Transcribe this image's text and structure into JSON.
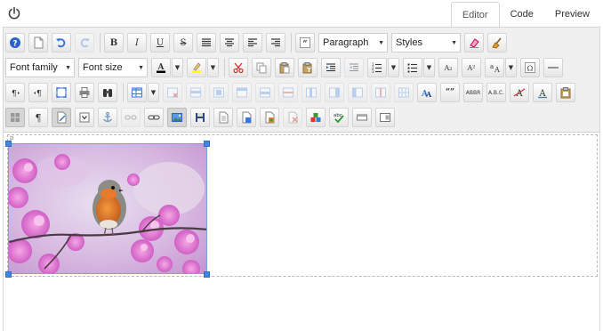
{
  "tabs": [
    {
      "label": "Editor",
      "active": true
    },
    {
      "label": "Code",
      "active": false
    },
    {
      "label": "Preview",
      "active": false
    }
  ],
  "toolbar": {
    "format_select": "Paragraph",
    "styles_select": "Styles",
    "font_family_select": "Font family",
    "font_size_select": "Font size",
    "bold": "B",
    "italic": "I",
    "underline": "U",
    "strikethrough": "S",
    "subscript": "A₂",
    "superscript": "A²",
    "omega": "Ω",
    "quote_marks": "“”",
    "abbr": "ABBR",
    "acronym": "A.B.C.",
    "pilcrow": "¶",
    "spell": "abc"
  },
  "colors": {
    "accent": "#3b88e5",
    "toolbar_bg": "#f0f0f0",
    "font_color_bar": "#000000",
    "highlight_color_bar": "#ffff00"
  },
  "icons": {
    "row1": [
      "help-icon",
      "new-document-icon",
      "undo-icon",
      "redo-icon",
      "bold-icon",
      "italic-icon",
      "underline-icon",
      "strikethrough-icon",
      "align-justify-icon",
      "align-center-icon",
      "align-left-icon",
      "align-right-icon",
      "blockquote-icon",
      "format-select",
      "styles-select",
      "eraser-icon",
      "clean-icon"
    ],
    "row2": [
      "font-family-select",
      "font-size-select",
      "font-color-icon",
      "highlight-icon",
      "cut-icon",
      "copy-icon",
      "paste-icon",
      "paste-text-icon",
      "indent-icon",
      "outdent-icon",
      "numbered-list-icon",
      "bullet-list-icon",
      "subscript-icon",
      "superscript-icon",
      "text-direction-icon",
      "special-char-icon",
      "horizontal-rule-icon"
    ],
    "row3": [
      "ltr-icon",
      "rtl-icon",
      "fullscreen-icon",
      "print-icon",
      "find-icon",
      "table-icon",
      "delete-table-icon",
      "insert-row-before-icon",
      "insert-row-after-icon",
      "delete-row-icon",
      "insert-col-before-icon",
      "insert-col-after-icon",
      "delete-col-icon",
      "split-cell-icon",
      "merge-cells-icon",
      "cell-props-icon",
      "remove-format-icon",
      "quote-icon",
      "abbr-icon",
      "acronym-icon",
      "strike-a-icon",
      "text-style-icon",
      "clipboard-icon"
    ],
    "row4": [
      "show-blocks-icon",
      "show-paragraphs-icon",
      "edit-document-icon",
      "form-icon",
      "anchor-icon",
      "unlink-icon",
      "link-icon",
      "image-icon",
      "save-icon",
      "template-icon",
      "insert-file-icon",
      "attach-file-icon",
      "delete-file-icon",
      "plugins-icon",
      "spellcheck-icon",
      "textbox-icon",
      "layer-icon"
    ]
  },
  "editor": {
    "paragraph_tag": "p"
  }
}
